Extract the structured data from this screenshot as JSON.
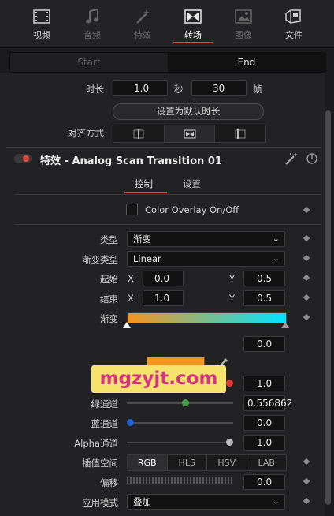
{
  "tabs": [
    {
      "label": "视频",
      "icon": "video-film-icon",
      "state": "normal"
    },
    {
      "label": "音频",
      "icon": "music-note-icon",
      "state": "dim"
    },
    {
      "label": "特效",
      "icon": "magic-wand-icon",
      "state": "dim"
    },
    {
      "label": "转场",
      "icon": "transition-bowtie-icon",
      "state": "active"
    },
    {
      "label": "图像",
      "icon": "image-icon",
      "state": "dim"
    },
    {
      "label": "文件",
      "icon": "file-icon",
      "state": "normal"
    }
  ],
  "start_end": {
    "start": "Start",
    "end": "End"
  },
  "duration": {
    "label": "时长",
    "seconds_value": "1.0",
    "seconds_unit": "秒",
    "frames_value": "30",
    "frames_unit": "帧",
    "default_button": "设置为默认时长"
  },
  "alignment": {
    "label": "对齐方式"
  },
  "effect": {
    "title": "特效 - Analog Scan Transition 01",
    "tabs": [
      "控制",
      "设置"
    ],
    "active_tab": "控制"
  },
  "color_overlay": {
    "label": "Color Overlay On/Off"
  },
  "type": {
    "label": "类型",
    "value": "渐变"
  },
  "gradient_type": {
    "label": "渐变类型",
    "value": "Linear"
  },
  "start_point": {
    "label": "起始",
    "x_label": "X",
    "x": "0.0",
    "y_label": "Y",
    "y": "0.5"
  },
  "end_point": {
    "label": "结束",
    "x_label": "X",
    "x": "1.0",
    "y_label": "Y",
    "y": "0.5"
  },
  "gradient": {
    "label": "渐变",
    "value": "0.0"
  },
  "red": {
    "value": "1.0",
    "level": 1.0
  },
  "green": {
    "label": "绿通道",
    "value": "0.556862",
    "level": 0.556862
  },
  "blue": {
    "label": "蓝通道",
    "value": "0.0",
    "level": 0.0
  },
  "alpha": {
    "label": "Alpha通道",
    "value": "1.0",
    "level": 1.0
  },
  "interp": {
    "label": "插值空间",
    "options": [
      "RGB",
      "HLS",
      "HSV",
      "LAB"
    ],
    "selected": "RGB"
  },
  "offset": {
    "label": "偏移",
    "value": "0.0"
  },
  "blend_mode": {
    "label": "应用模式",
    "value": "叠加"
  },
  "watermark": {
    "text": "mgzyjt.com"
  },
  "colors": {
    "accent": "#e0483c",
    "gradient_start": "#f7931e",
    "gradient_end": "#00e5ff",
    "swatch": "#f7931e",
    "watermark_bg": "#f5e36b",
    "watermark_text": "#d63384"
  }
}
